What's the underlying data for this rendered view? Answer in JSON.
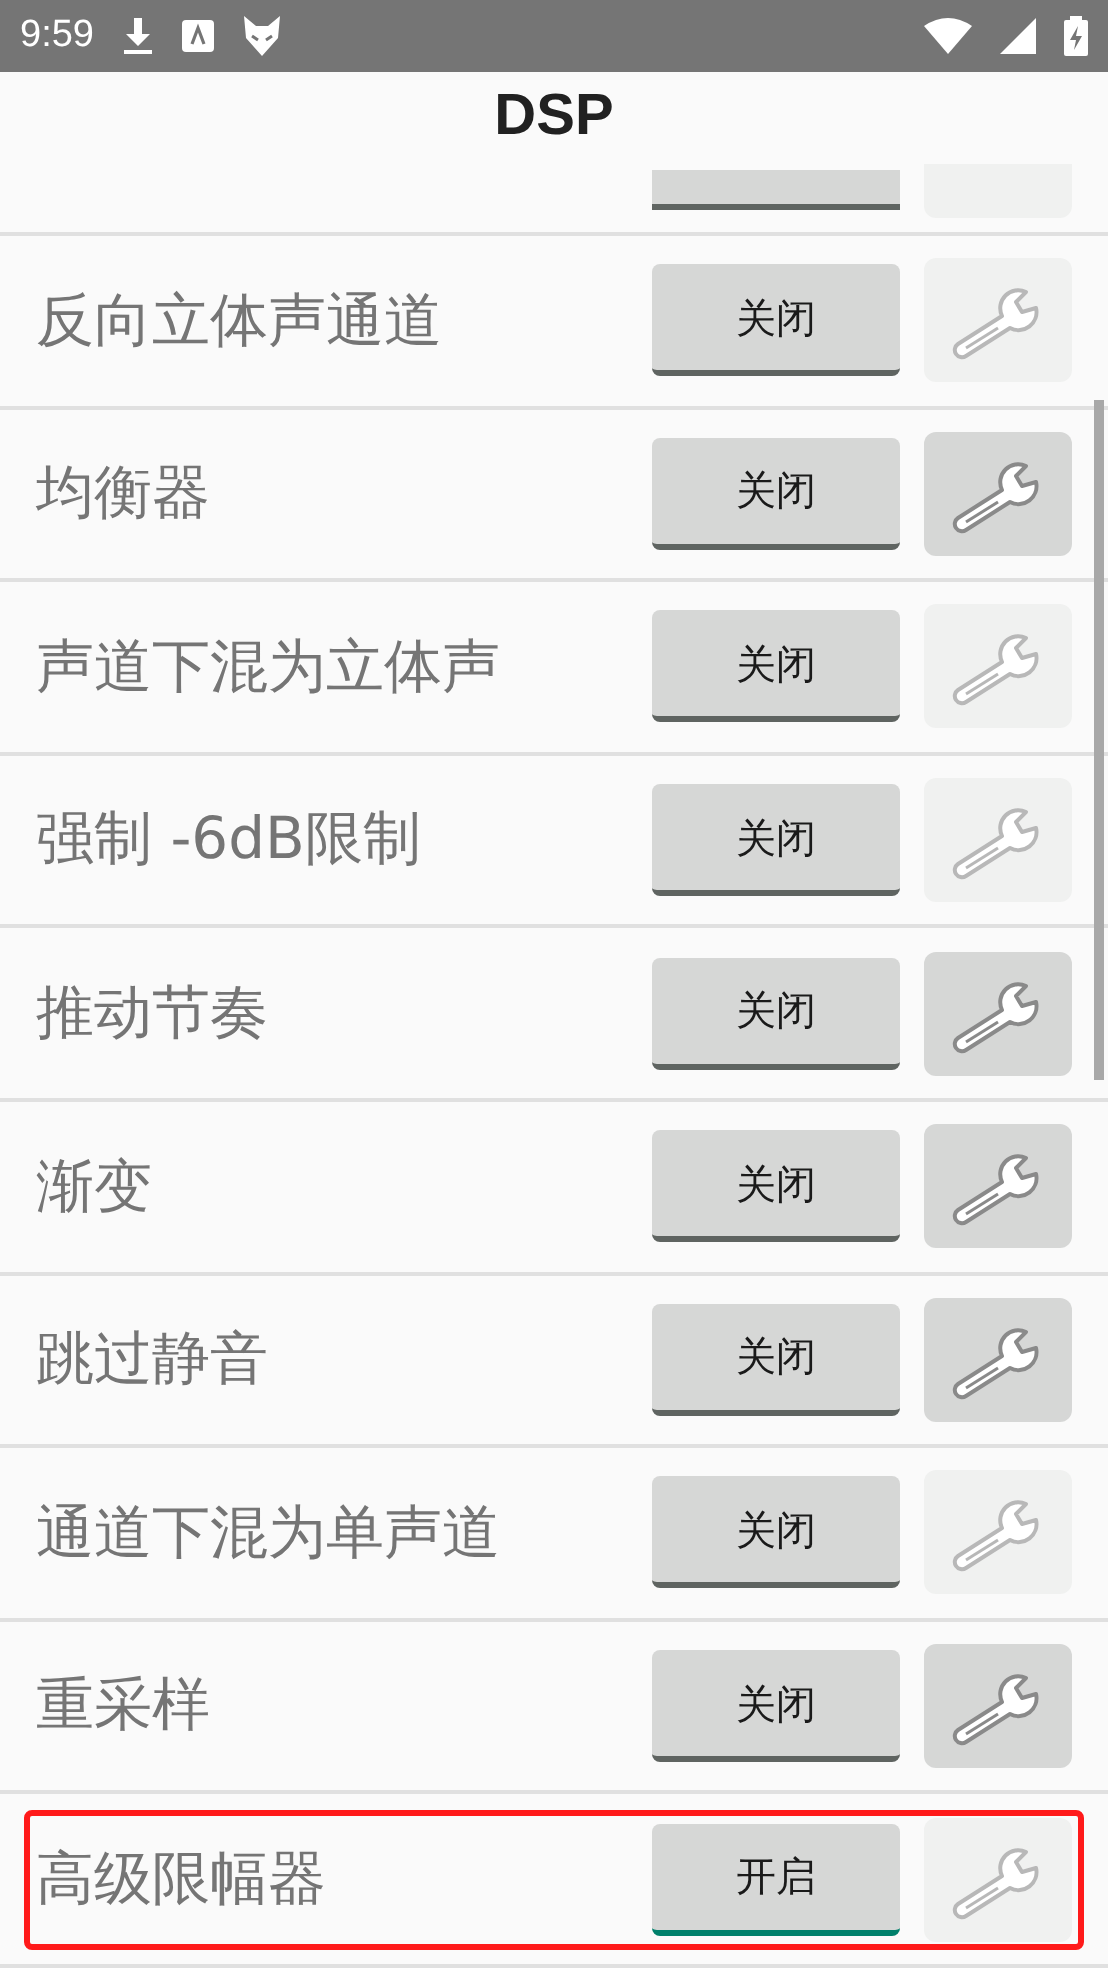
{
  "status_bar": {
    "time": "9:59"
  },
  "title": "DSP",
  "partial_row": {
    "settings_enabled": false
  },
  "rows": [
    {
      "label": "反向立体声通道",
      "button": "关闭",
      "on": false,
      "settings_enabled": false,
      "highlighted": false
    },
    {
      "label": "均衡器",
      "button": "关闭",
      "on": false,
      "settings_enabled": true,
      "highlighted": false
    },
    {
      "label": "声道下混为立体声",
      "button": "关闭",
      "on": false,
      "settings_enabled": false,
      "highlighted": false
    },
    {
      "label": "强制 -6dB限制",
      "button": "关闭",
      "on": false,
      "settings_enabled": false,
      "highlighted": false
    },
    {
      "label": "推动节奏",
      "button": "关闭",
      "on": false,
      "settings_enabled": true,
      "highlighted": false
    },
    {
      "label": "渐变",
      "button": "关闭",
      "on": false,
      "settings_enabled": true,
      "highlighted": false
    },
    {
      "label": "跳过静音",
      "button": "关闭",
      "on": false,
      "settings_enabled": true,
      "highlighted": false
    },
    {
      "label": "通道下混为单声道",
      "button": "关闭",
      "on": false,
      "settings_enabled": false,
      "highlighted": false
    },
    {
      "label": "重采样",
      "button": "关闭",
      "on": false,
      "settings_enabled": true,
      "highlighted": false
    },
    {
      "label": "高级限幅器",
      "button": "开启",
      "on": true,
      "settings_enabled": false,
      "highlighted": true
    }
  ]
}
